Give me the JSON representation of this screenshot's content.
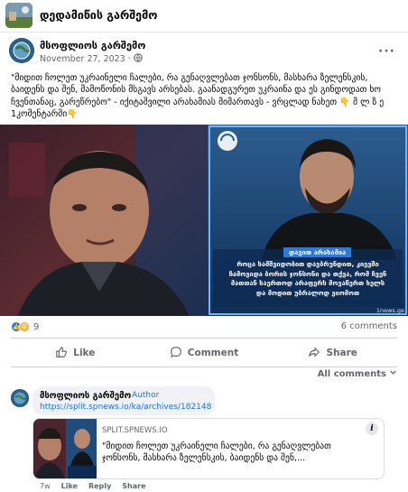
{
  "header": {
    "group_name": "დედამიწის გარშემო"
  },
  "post": {
    "author": "მსოფლიოს გარშემო",
    "date": "November 27, 2023 ·",
    "text": "\"მიდით ჩოლეთ უკრაინელი ჩალები, რა გენაღვლებათ ჯონსონს, მასხარა ზელენსკის, ბაიდენს და შენ, მამოწონის მსგავს არსებას. გაანადგურეთ უკრაინა და ეს გინდოდათ ხო ჩვენთანაც, გარეწრებო\" - იქიტაშვილი არახამიას მიმართავს - ვრცლად ნახეთ 👇 მ ლ ზ ე 1კომენტარში👇",
    "media": {
      "caption_name": "დავით არახამია",
      "caption_line1": "როცა სამშვიდობით დავბრუნდით, კიევში",
      "caption_line2": "ჩამოვიდა ბორის ჯონსონი და თქვა, რომ ჩვენ",
      "caption_line3": "მათთან საერთოდ არაფერს მოვაწერთ ხელს",
      "caption_line4": "და მოდით უბრალოდ ვიომოთ",
      "watermark": "1news.ge"
    },
    "reactions_count": "9",
    "comments_count": "6 comments"
  },
  "actions": {
    "like": "Like",
    "comment": "Comment",
    "share": "Share"
  },
  "all_comments": "All comments",
  "comment": {
    "author": "მსოფლიოს გარშემო",
    "badge": "Author",
    "link": "https://split.spnews.io/ka/archives/182148",
    "card_domain": "SPLIT.SPNEWS.IO",
    "card_text": "\"მიდით ჩოლეთ უკრაინელი ჩალები, რა გენაღვლებათ ჯონსონს, მასხარა ზელენსკის, ბაიდენს და შენ,...",
    "time": "7w",
    "like": "Like",
    "reply": "Reply",
    "share": "Share"
  },
  "colors": {
    "link_blue": "#1b74e4",
    "muted_gray": "#65676b",
    "like_blue": "#1877f2",
    "love_red": "#f33e58"
  }
}
